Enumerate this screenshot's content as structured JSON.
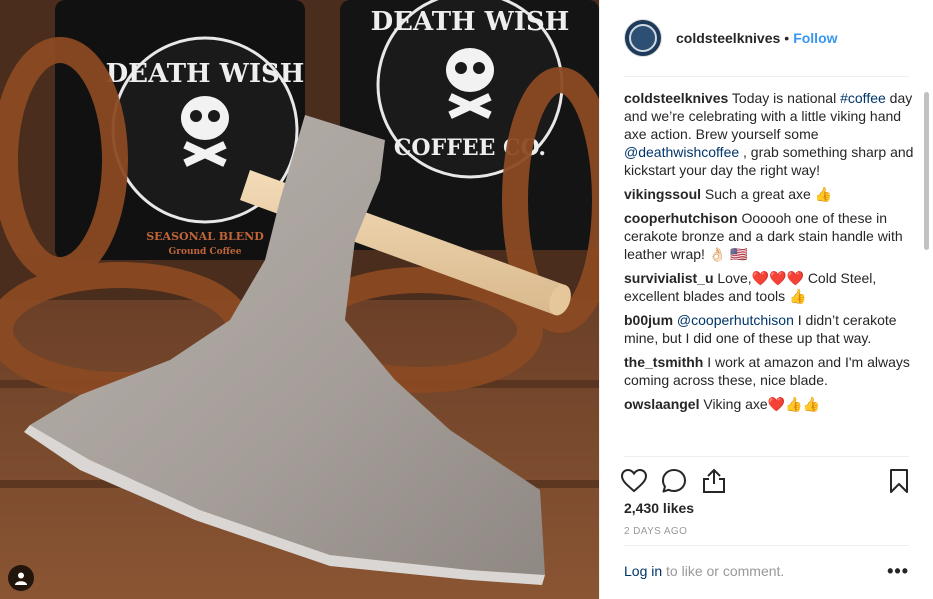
{
  "post": {
    "username": "coldsteelknives",
    "separator": "•",
    "follow_label": "Follow",
    "caption": {
      "user": "coldsteelknives",
      "t1": " Today is national ",
      "hashtag": "#coffee",
      "t2": " day and we’re celebrating with a little viking hand axe action. Brew yourself some ",
      "mention": "@deathwishcoffee",
      "t3": " , grab something sharp and kickstart your day the right way!"
    },
    "comments": [
      {
        "user": "vikingssoul",
        "text": " Such a great axe 👍"
      },
      {
        "user": "cooperhutchison",
        "text": " Oooooh one of these in cerakote bronze and a dark stain handle with leather wrap! 👌🏻 🇺🇸"
      },
      {
        "user": "survivialist_u",
        "text": " Love,❤️❤️❤️ Cold Steel, excellent blades and tools 👍"
      },
      {
        "user": "b00jum",
        "mention": " @cooperhutchison",
        "text": " I didn’t cerakote mine, but I did one of these up that way."
      },
      {
        "user": "the_tsmithh",
        "text": " I work at amazon and I'm always coming across these, nice blade."
      },
      {
        "user": "owslaangel",
        "text": " Viking axe❤️👍👍"
      }
    ],
    "likes": "2,430 likes",
    "date": "2 DAYS AGO",
    "login_link": "Log in",
    "login_rest": " to like or comment.",
    "more_label": "•••"
  },
  "photo": {
    "bag_brand_top": "DEATH WISH",
    "bag_brand_bottom": "COFFEE CO.",
    "bag_left_bottom": "SEASONAL BLEND",
    "bag_left_sub": "Ground Coffee"
  },
  "icons": [
    "heart-icon",
    "comment-icon",
    "share-icon",
    "bookmark-icon",
    "user-tag-icon"
  ],
  "colors": {
    "accent": "#3897f0",
    "link": "#003569",
    "muted": "#999999"
  }
}
